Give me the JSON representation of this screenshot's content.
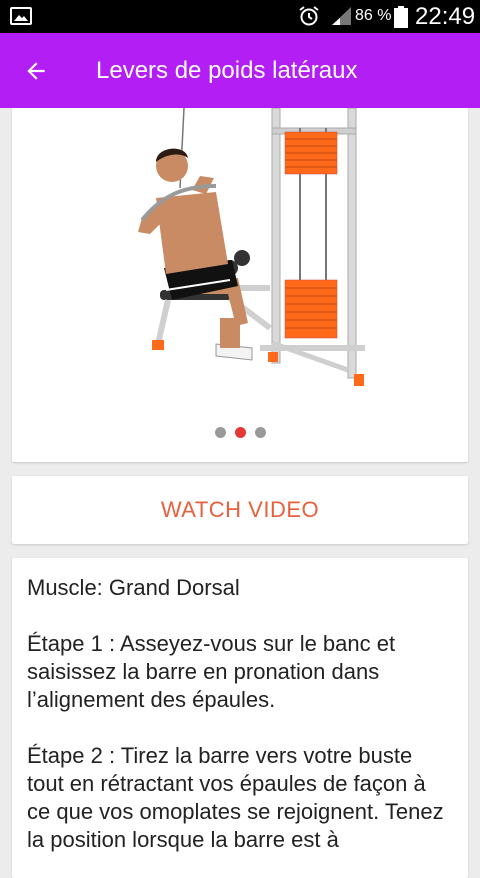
{
  "status_bar": {
    "battery_percent": "86 %",
    "time": "22:49",
    "icons": [
      "image-notification-icon",
      "alarm-icon",
      "signal-icon",
      "battery-icon"
    ]
  },
  "app_bar": {
    "title": "Levers de poids latéraux",
    "back_icon": "arrow-left-icon",
    "background": "#b31ef5"
  },
  "carousel": {
    "page_count": 3,
    "active_index": 1,
    "accent": "#e53935"
  },
  "video": {
    "label": "WATCH VIDEO",
    "color": "#e8603c"
  },
  "description": {
    "muscle": "Muscle: Grand Dorsal",
    "step1": "Étape 1 : Asseyez-vous sur le banc et saisissez la barre en pronation dans l’alignement des épaules.",
    "step2": "Étape 2 : Tirez la barre vers votre buste tout en rétractant vos épaules de façon à ce que vos omoplates se rejoignent. Tenez la position lorsque la barre est à"
  }
}
